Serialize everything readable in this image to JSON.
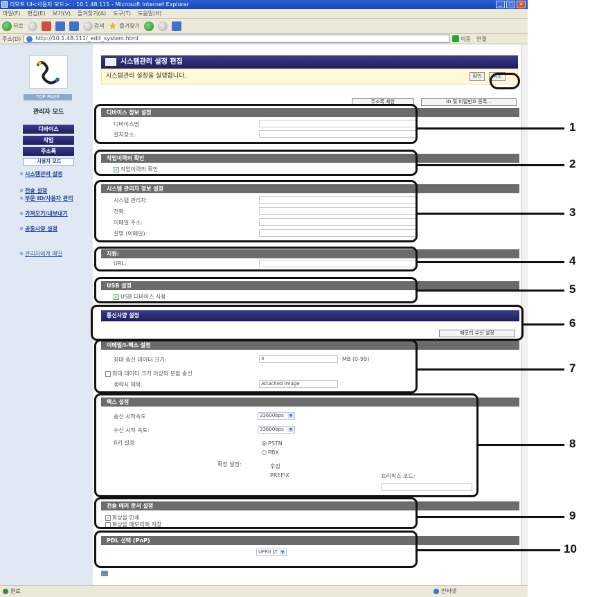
{
  "window": {
    "title": "리모트 UI<사용자 모드>: : 10.1.48.111 - Microsoft Internet Explorer"
  },
  "menu": [
    "파일(F)",
    "편집(E)",
    "보기(V)",
    "즐겨찾기(A)",
    "도구(T)",
    "도움말(H)"
  ],
  "toolbar": {
    "back": "뒤로",
    "search": "검색",
    "favorites": "즐겨찾기"
  },
  "address": {
    "label": "주소(D)",
    "url": "http://10.1.48.111/_edit_system.html",
    "go": "이동",
    "links": "연결"
  },
  "sidebar": {
    "top_link": "TOP PAGE",
    "mode_label": "관리자 모드",
    "buttons": [
      "디바이스",
      "작업",
      "주소록",
      "사용자 모드"
    ],
    "links": [
      "시스템관리 설정",
      "전송 설정",
      "부문 ID/사용자 관리",
      "가져오기/내보내기",
      "공통사양 설정"
    ],
    "mail_link": "관리자에게 메일"
  },
  "header": {
    "title": "시스템관리 설정 편집",
    "message": "시스템관리 설정을 실행합니다.",
    "ok": "확인",
    "cancel": "취소"
  },
  "top_buttons": {
    "address_limit": "주소록 제한",
    "id_password": "ID 및 비밀번호 등록..."
  },
  "sections": {
    "device_info": {
      "title": "디바이스 정보 설정",
      "name": "디바이스명",
      "location": "설치장소:"
    },
    "job_log": {
      "title": "작업이력의 확인",
      "checkbox": "작업이력의 확인"
    },
    "admin_info": {
      "title": "시스템 관리자 정보 설정",
      "admin": "시스템 관리자:",
      "phone": "전화:",
      "email": "이메일 주소:",
      "desc": "설명 (이메일):"
    },
    "support": {
      "title": "지원:",
      "url": "URL:"
    },
    "usb": {
      "title": "USB 설정",
      "checkbox": "USB 디바이스 사용"
    },
    "comm": {
      "title": "통신사양 설정",
      "memory_button": "메모리 수신 설정"
    },
    "email_fax": {
      "title": "이메일/I-팩스 설정",
      "max_size_label": "최대 송신 데이터 크기:",
      "max_size_value": "3",
      "max_size_unit": "MB (0-99)",
      "split_checkbox": "최대 데이터 크기 이상의 분할 송신",
      "subject_label": "생략시 제목:",
      "subject_value": "Attached Image"
    },
    "fax": {
      "title": "팩스 설정",
      "tx_speed_label": "송신 시작속도",
      "tx_speed": "33600bps",
      "rx_speed_label": "수신 시작 속도:",
      "rx_speed": "33600bps",
      "r_key_label": "R키 설정",
      "pstn": "PSTN",
      "pbx": "PBX",
      "ext_label": "확장 설정:",
      "ext_hook": "후킹",
      "ext_prefix": "PREFIX",
      "prefix_code": "프리픽스 코드:"
    },
    "tx_error": {
      "title": "전송 에러 문서 설정",
      "print": "화상을 인쇄",
      "save": "화상을 메모리에 저장"
    },
    "pdl": {
      "title": "PDL 선택 (PnP)",
      "value": "UFRII LT"
    }
  },
  "callouts": [
    "1",
    "2",
    "3",
    "4",
    "5",
    "6",
    "7",
    "8",
    "9",
    "10"
  ],
  "status": {
    "left": "완료",
    "right": "인터넷"
  }
}
